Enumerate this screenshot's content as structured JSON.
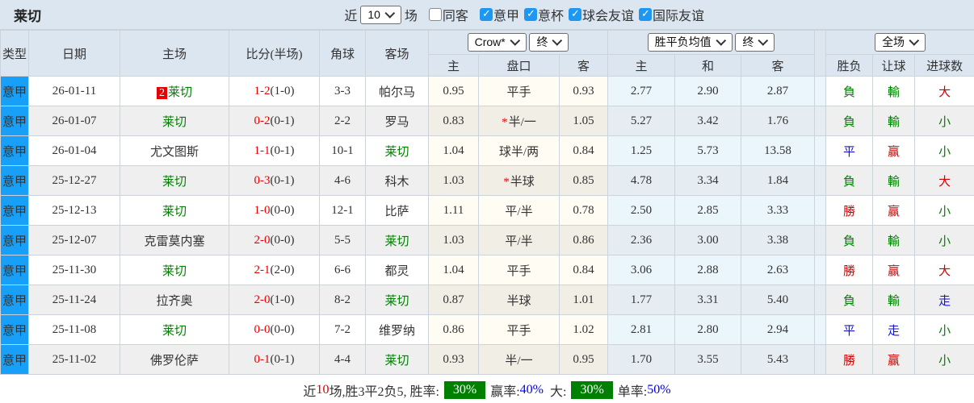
{
  "title": "莱切",
  "colors": {
    "accent_blue": "#18a0f8",
    "focus_green": "#008000",
    "loss_red": "#d10000",
    "draw_blue": "#1414cc",
    "badge_green": "#008000",
    "header_bg": "#dce6f0"
  },
  "filter_bar": {
    "recent_label": "近",
    "recent_value": "10",
    "recent_suffix": "场",
    "checkboxes": [
      {
        "label": "同客",
        "checked": false
      },
      {
        "label": "意甲",
        "checked": true
      },
      {
        "label": "意杯",
        "checked": true
      },
      {
        "label": "球会友谊",
        "checked": true
      },
      {
        "label": "国际友谊",
        "checked": true
      }
    ]
  },
  "table": {
    "header": {
      "type": "类型",
      "date": "日期",
      "home": "主场",
      "score": "比分(半场)",
      "corner": "角球",
      "away": "客场",
      "odds_source": "Crow*",
      "odds_stage": "终",
      "avg_label": "胜平负均值",
      "avg_stage": "终",
      "scope": "全场",
      "sub_home": "主",
      "sub_handicap": "盘口",
      "sub_away": "客",
      "sub_avg_home": "主",
      "sub_avg_draw": "和",
      "sub_avg_away": "客",
      "sub_result": "胜负",
      "sub_handicap_result": "让球",
      "sub_goals": "进球数"
    },
    "rows": [
      {
        "league": "意甲",
        "date": "26-01-11",
        "home": "莱切",
        "home_badge": "2",
        "home_focus": true,
        "score": "1-2",
        "half": "(1-0)",
        "corner": "3-3",
        "away": "帕尔马",
        "away_focus": false,
        "odds_home": "0.95",
        "handicap": "平手",
        "handicap_star": false,
        "odds_away": "0.93",
        "avg_home": "2.77",
        "avg_draw": "2.90",
        "avg_away": "2.87",
        "result": "負",
        "result_color": "green",
        "handicap_result": "輸",
        "handicap_result_color": "green",
        "goals": "大",
        "goals_color": "red"
      },
      {
        "league": "意甲",
        "date": "26-01-07",
        "home": "莱切",
        "home_badge": "",
        "home_focus": true,
        "score": "0-2",
        "half": "(0-1)",
        "corner": "2-2",
        "away": "罗马",
        "away_focus": false,
        "odds_home": "0.83",
        "handicap": "半/一",
        "handicap_star": true,
        "odds_away": "1.05",
        "avg_home": "5.27",
        "avg_draw": "3.42",
        "avg_away": "1.76",
        "result": "負",
        "result_color": "green",
        "handicap_result": "輸",
        "handicap_result_color": "green",
        "goals": "小",
        "goals_color": "green"
      },
      {
        "league": "意甲",
        "date": "26-01-04",
        "home": "尤文图斯",
        "home_badge": "",
        "home_focus": false,
        "score": "1-1",
        "half": "(0-1)",
        "corner": "10-1",
        "away": "莱切",
        "away_focus": true,
        "odds_home": "1.04",
        "handicap": "球半/两",
        "handicap_star": false,
        "odds_away": "0.84",
        "avg_home": "1.25",
        "avg_draw": "5.73",
        "avg_away": "13.58",
        "result": "平",
        "result_color": "blue",
        "handicap_result": "赢",
        "handicap_result_color": "red",
        "goals": "小",
        "goals_color": "green"
      },
      {
        "league": "意甲",
        "date": "25-12-27",
        "home": "莱切",
        "home_badge": "",
        "home_focus": true,
        "score": "0-3",
        "half": "(0-1)",
        "corner": "4-6",
        "away": "科木",
        "away_focus": false,
        "odds_home": "1.03",
        "handicap": "半球",
        "handicap_star": true,
        "odds_away": "0.85",
        "avg_home": "4.78",
        "avg_draw": "3.34",
        "avg_away": "1.84",
        "result": "負",
        "result_color": "green",
        "handicap_result": "輸",
        "handicap_result_color": "green",
        "goals": "大",
        "goals_color": "red"
      },
      {
        "league": "意甲",
        "date": "25-12-13",
        "home": "莱切",
        "home_badge": "",
        "home_focus": true,
        "score": "1-0",
        "half": "(0-0)",
        "corner": "12-1",
        "away": "比萨",
        "away_focus": false,
        "odds_home": "1.11",
        "handicap": "平/半",
        "handicap_star": false,
        "odds_away": "0.78",
        "avg_home": "2.50",
        "avg_draw": "2.85",
        "avg_away": "3.33",
        "result": "勝",
        "result_color": "red",
        "handicap_result": "赢",
        "handicap_result_color": "red",
        "goals": "小",
        "goals_color": "green"
      },
      {
        "league": "意甲",
        "date": "25-12-07",
        "home": "克雷莫内塞",
        "home_badge": "",
        "home_focus": false,
        "score": "2-0",
        "half": "(0-0)",
        "corner": "5-5",
        "away": "莱切",
        "away_focus": true,
        "odds_home": "1.03",
        "handicap": "平/半",
        "handicap_star": false,
        "odds_away": "0.86",
        "avg_home": "2.36",
        "avg_draw": "3.00",
        "avg_away": "3.38",
        "result": "負",
        "result_color": "green",
        "handicap_result": "輸",
        "handicap_result_color": "green",
        "goals": "小",
        "goals_color": "green"
      },
      {
        "league": "意甲",
        "date": "25-11-30",
        "home": "莱切",
        "home_badge": "",
        "home_focus": true,
        "score": "2-1",
        "half": "(2-0)",
        "corner": "6-6",
        "away": "都灵",
        "away_focus": false,
        "odds_home": "1.04",
        "handicap": "平手",
        "handicap_star": false,
        "odds_away": "0.84",
        "avg_home": "3.06",
        "avg_draw": "2.88",
        "avg_away": "2.63",
        "result": "勝",
        "result_color": "red",
        "handicap_result": "赢",
        "handicap_result_color": "red",
        "goals": "大",
        "goals_color": "red"
      },
      {
        "league": "意甲",
        "date": "25-11-24",
        "home": "拉齐奥",
        "home_badge": "",
        "home_focus": false,
        "score": "2-0",
        "half": "(1-0)",
        "corner": "8-2",
        "away": "莱切",
        "away_focus": true,
        "odds_home": "0.87",
        "handicap": "半球",
        "handicap_star": false,
        "odds_away": "1.01",
        "avg_home": "1.77",
        "avg_draw": "3.31",
        "avg_away": "5.40",
        "result": "負",
        "result_color": "green",
        "handicap_result": "輸",
        "handicap_result_color": "green",
        "goals": "走",
        "goals_color": "blue"
      },
      {
        "league": "意甲",
        "date": "25-11-08",
        "home": "莱切",
        "home_badge": "",
        "home_focus": true,
        "score": "0-0",
        "half": "(0-0)",
        "corner": "7-2",
        "away": "维罗纳",
        "away_focus": false,
        "odds_home": "0.86",
        "handicap": "平手",
        "handicap_star": false,
        "odds_away": "1.02",
        "avg_home": "2.81",
        "avg_draw": "2.80",
        "avg_away": "2.94",
        "result": "平",
        "result_color": "blue",
        "handicap_result": "走",
        "handicap_result_color": "blue",
        "goals": "小",
        "goals_color": "green"
      },
      {
        "league": "意甲",
        "date": "25-11-02",
        "home": "佛罗伦萨",
        "home_badge": "",
        "home_focus": false,
        "score": "0-1",
        "half": "(0-1)",
        "corner": "4-4",
        "away": "莱切",
        "away_focus": true,
        "odds_home": "0.93",
        "handicap": "半/一",
        "handicap_star": false,
        "odds_away": "0.95",
        "avg_home": "1.70",
        "avg_draw": "3.55",
        "avg_away": "5.43",
        "result": "勝",
        "result_color": "red",
        "handicap_result": "赢",
        "handicap_result_color": "red",
        "goals": "小",
        "goals_color": "green"
      }
    ]
  },
  "summary": {
    "prefix": "近",
    "count": "10",
    "stats": "场,胜3平2负5, 胜率:",
    "win_rate": "30%",
    "odds_win_label": "赢率:",
    "odds_win": "40%",
    "big_label": "大:",
    "big_rate": "30%",
    "single_label": "单率:",
    "single_rate": "50%"
  }
}
